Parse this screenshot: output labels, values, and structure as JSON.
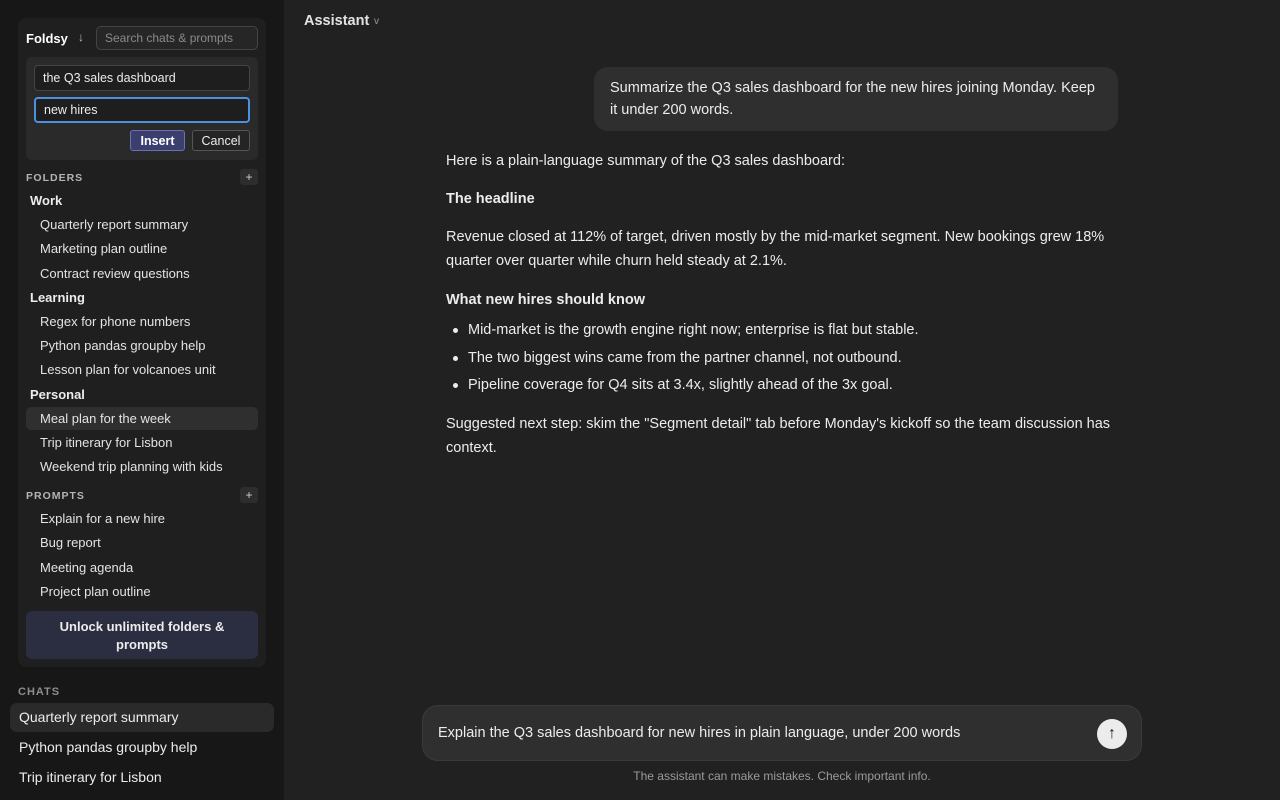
{
  "foldsy": {
    "brand": "Foldsy",
    "sort_icon": "↓",
    "search_placeholder": "Search chats & prompts",
    "variables": {
      "first_value": "the Q3 sales dashboard",
      "second_value": "new hires",
      "insert_label": "Insert",
      "cancel_label": "Cancel"
    },
    "folders_label": "FOLDERS",
    "add_label": "+",
    "folders": [
      {
        "name": "Work",
        "items": [
          "Quarterly report summary",
          "Marketing plan outline",
          "Contract review questions"
        ]
      },
      {
        "name": "Learning",
        "items": [
          "Regex for phone numbers",
          "Python pandas groupby help",
          "Lesson plan for volcanoes unit"
        ]
      },
      {
        "name": "Personal",
        "items": [
          "Meal plan for the week",
          "Trip itinerary for Lisbon",
          "Weekend trip planning with kids"
        ]
      }
    ],
    "prompts_label": "PROMPTS",
    "prompts": [
      "Explain for a new hire",
      "Bug report",
      "Meeting agenda",
      "Project plan outline"
    ],
    "unlock_label": "Unlock unlimited folders & prompts"
  },
  "chats": {
    "label": "CHATS",
    "items": [
      "Quarterly report summary",
      "Python pandas groupby help",
      "Trip itinerary for Lisbon"
    ]
  },
  "topbar": {
    "title": "Assistant",
    "caret": "v"
  },
  "conversation": {
    "user_message": "Summarize the Q3 sales dashboard for the new hires joining Monday. Keep it under 200 words.",
    "intro": "Here is a plain-language summary of the Q3 sales dashboard:",
    "headline_heading": "The headline",
    "headline_text": "Revenue closed at 112% of target, driven mostly by the mid-market segment. New bookings grew 18% quarter over quarter while churn held steady at 2.1%.",
    "know_heading": "What new hires should know",
    "bullets": [
      "Mid-market is the growth engine right now; enterprise is flat but stable.",
      "The two biggest wins came from the partner channel, not outbound.",
      "Pipeline coverage for Q4 sits at 3.4x, slightly ahead of the 3x goal."
    ],
    "next_step": "Suggested next step: skim the \"Segment detail\" tab before Monday's kickoff so the team discussion has context."
  },
  "composer": {
    "text": "Explain the Q3 sales dashboard for new hires in plain language, under 200 words",
    "send_icon": "↑",
    "disclaimer": "The assistant can make mistakes. Check important info."
  }
}
